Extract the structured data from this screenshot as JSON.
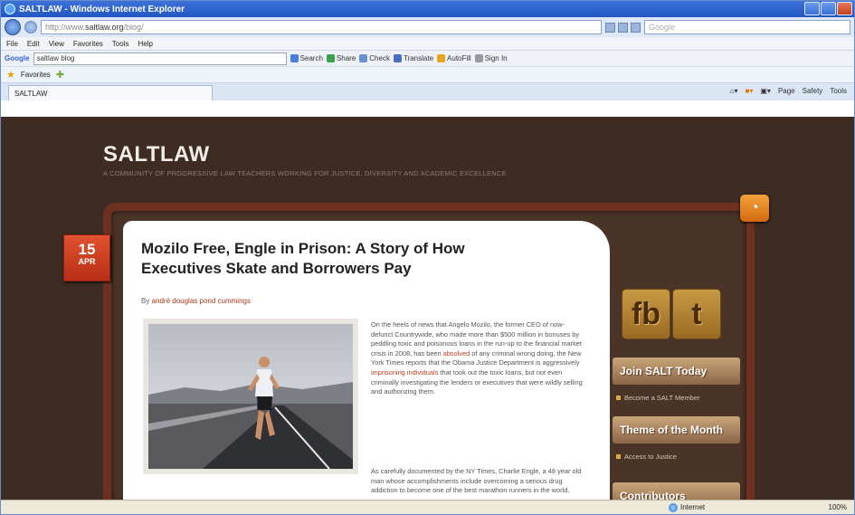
{
  "window": {
    "title": "SALTLAW - Windows Internet Explorer"
  },
  "address": {
    "scheme": "http://www.",
    "domain": "saltlaw.org",
    "path": "/blog/",
    "search_placeholder": "Google"
  },
  "menu": [
    "File",
    "Edit",
    "View",
    "Favorites",
    "Tools",
    "Help"
  ],
  "googlebar": {
    "logo": "Google",
    "query": "saltlaw blog",
    "buttons": [
      "Search",
      "Share",
      "Check",
      "Translate",
      "AutoFill",
      "Sign In"
    ]
  },
  "favorites": {
    "label": "Favorites"
  },
  "tab": {
    "label": "SALTLAW"
  },
  "tabtools": [
    "Page",
    "Safety",
    "Tools"
  ],
  "site": {
    "title": "SALTLAW",
    "tagline": "A COMMUNITY OF PROGRESSIVE LAW TEACHERS WORKING FOR JUSTICE, DIVERSITY AND ACADEMIC EXCELLENCE"
  },
  "post": {
    "day": "15",
    "month": "APR",
    "title": "Mozilo Free, Engle in Prison: A Story of How Executives Skate and Borrowers Pay",
    "by_prefix": "By",
    "author": "andré douglas pond cummings",
    "para1_a": "On the heels of news that Angelo Mozilo, the former CEO of now-defunct Countrywide, who made more than $500 million in bonuses by peddling toxic and poisonous loans in the run-up to the financial market crisis in 2008, has been ",
    "para1_link1": "absolved",
    "para1_b": " of any criminal wrong doing, the New York Times reports that the Obama Justice Department is aggressively ",
    "para1_link2": "imprisoning individuals",
    "para1_c": " that took out the toxic loans, but not even criminally investigating the lenders or executives that were wildly selling and authorizing them.",
    "para2": "As carefully documented by the NY Times, Charlie Engle, a 48 year old man whose accomplishments include overcoming a serious drug addiction to become one of the best marathon runners in the world,"
  },
  "sidebar": {
    "social": [
      "fb",
      "t"
    ],
    "join_head": "Join SALT Today",
    "join_link": "Become a SALT Member",
    "theme_head": "Theme of the Month",
    "theme_link": "Access to Justice",
    "contrib_head": "Contributors"
  },
  "status": {
    "zone": "Internet",
    "zoom": "100%"
  }
}
